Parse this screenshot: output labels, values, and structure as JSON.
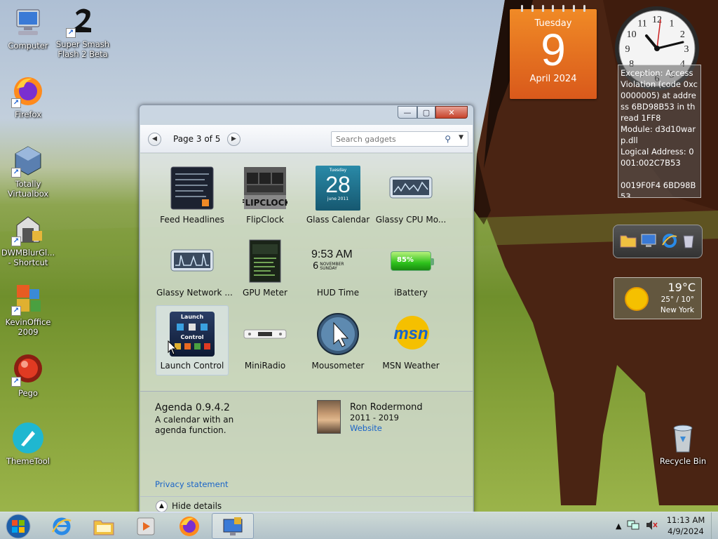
{
  "desktop": {
    "icons": [
      {
        "label": "Computer",
        "icon": "computer-icon"
      },
      {
        "label": "Super Smash Flash 2 Beta",
        "icon": "ssf2-icon"
      },
      {
        "label": "Firefox",
        "icon": "firefox-icon"
      },
      {
        "label": "Totally Virtualbox",
        "icon": "virtualbox-icon"
      },
      {
        "label": "DWMBlurGl... - Shortcut",
        "icon": "dwmblur-icon"
      },
      {
        "label": "KevinOffice 2009",
        "icon": "office-icon"
      },
      {
        "label": "Pego",
        "icon": "pego-icon"
      },
      {
        "label": "ThemeTool",
        "icon": "themetool-icon"
      },
      {
        "label": "Recycle Bin",
        "icon": "recycle-bin-icon"
      }
    ]
  },
  "calendar_gadget": {
    "weekday": "Tuesday",
    "day": "9",
    "month_year": "April 2024"
  },
  "clock_gadget": {
    "numerals": [
      "12",
      "1",
      "2",
      "3",
      "4",
      "5",
      "6",
      "7",
      "8",
      "9",
      "10",
      "11"
    ]
  },
  "error_box": {
    "text": "Exception: Access Violation (code 0xc0000005) at address 6BD98B53 in thread 1FF8\nModule: d3d10warp.dll\nLogical Address: 0001:002C7B53\n\n0019F0F4 6BD98B53"
  },
  "weather_gadget": {
    "temp": "19°C",
    "range": "25° / 10°",
    "city": "New York"
  },
  "gallery": {
    "page_label": "Page 3 of 5",
    "search_placeholder": "Search gadgets",
    "controls": {
      "minimize": "—",
      "maximize": "▢",
      "close": "✕"
    },
    "gadgets": [
      {
        "name": "Feed Headlines",
        "icon": "feed-headlines-icon"
      },
      {
        "name": "FlipClock",
        "icon": "flipclock-icon"
      },
      {
        "name": "Glass Calendar",
        "icon": "glass-calendar-icon",
        "weekday": "Tuesday",
        "day": "28",
        "month": "june 2011"
      },
      {
        "name": "Glassy CPU Mo...",
        "icon": "glassy-cpu-icon"
      },
      {
        "name": "Glassy Network ...",
        "icon": "glassy-network-icon"
      },
      {
        "name": "GPU Meter",
        "icon": "gpu-meter-icon"
      },
      {
        "name": "HUD Time",
        "icon": "hud-time-icon",
        "time": "9:53 AM",
        "date_num": "6",
        "date_month": "NOVEMBER",
        "date_day": "SUNDAY"
      },
      {
        "name": "iBattery",
        "icon": "battery-icon",
        "level": "85%"
      },
      {
        "name": "Launch Control",
        "icon": "launch-control-icon",
        "title": "Launch",
        "sub": "Control"
      },
      {
        "name": "MiniRadio",
        "icon": "miniradio-icon"
      },
      {
        "name": "Mousometer",
        "icon": "mousometer-icon"
      },
      {
        "name": "MSN Weather",
        "icon": "msn-weather-icon",
        "brand": "msn"
      }
    ],
    "details": {
      "name": "Agenda 0.9.4.2",
      "description": "A calendar with an agenda function.",
      "author": "Ron Rodermond",
      "years": "2011 - 2019",
      "website": "Website",
      "privacy": "Privacy statement"
    },
    "hide_details": "Hide details"
  },
  "taskbar": {
    "apps": [
      "internet-explorer-icon",
      "file-explorer-icon",
      "media-player-icon",
      "firefox-icon",
      "gadgets-icon"
    ],
    "time": "11:13 AM",
    "date": "4/9/2024"
  }
}
